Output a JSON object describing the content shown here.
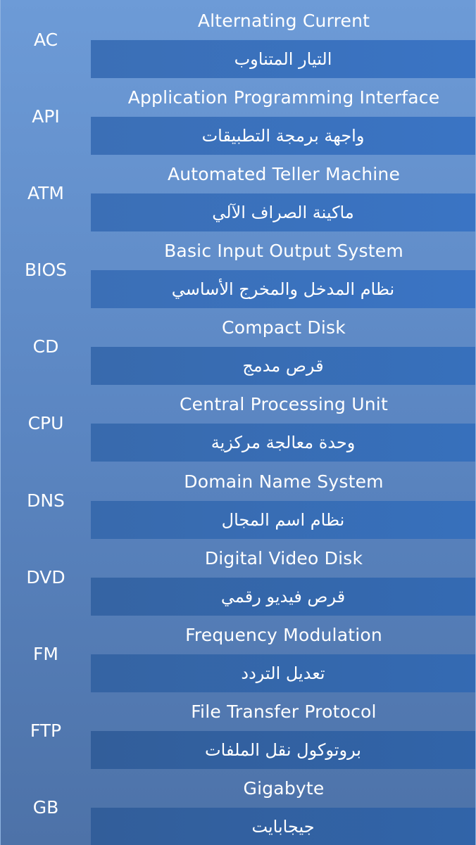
{
  "rows": [
    {
      "abbr": "AC",
      "english": "Alternating Current",
      "arabic": "التيار المتناوب"
    },
    {
      "abbr": "API",
      "english": "Application Programming Interface",
      "arabic": "واجهة برمجة التطبيقات"
    },
    {
      "abbr": "ATM",
      "english": "Automated Teller Machine",
      "arabic": "ماكينة الصراف الآلي"
    },
    {
      "abbr": "BIOS",
      "english": "Basic Input Output System",
      "arabic": "نظام المدخل والمخرج الأساسي"
    },
    {
      "abbr": "CD",
      "english": "Compact Disk",
      "arabic": "قرص مدمج"
    },
    {
      "abbr": "CPU",
      "english": "Central Processing Unit",
      "arabic": "وحدة معالجة مركزية"
    },
    {
      "abbr": "DNS",
      "english": "Domain Name System",
      "arabic": "نظام اسم المجال"
    },
    {
      "abbr": "DVD",
      "english": "Digital Video Disk",
      "arabic": "قرص فيديو رقمي"
    },
    {
      "abbr": "FM",
      "english": "Frequency Modulation",
      "arabic": "تعديل التردد"
    },
    {
      "abbr": "FTP",
      "english": "File Transfer Protocol",
      "arabic": "بروتوكول نقل الملفات"
    },
    {
      "abbr": "GB",
      "english": "Gigabyte",
      "arabic": "جيجابايت"
    }
  ]
}
